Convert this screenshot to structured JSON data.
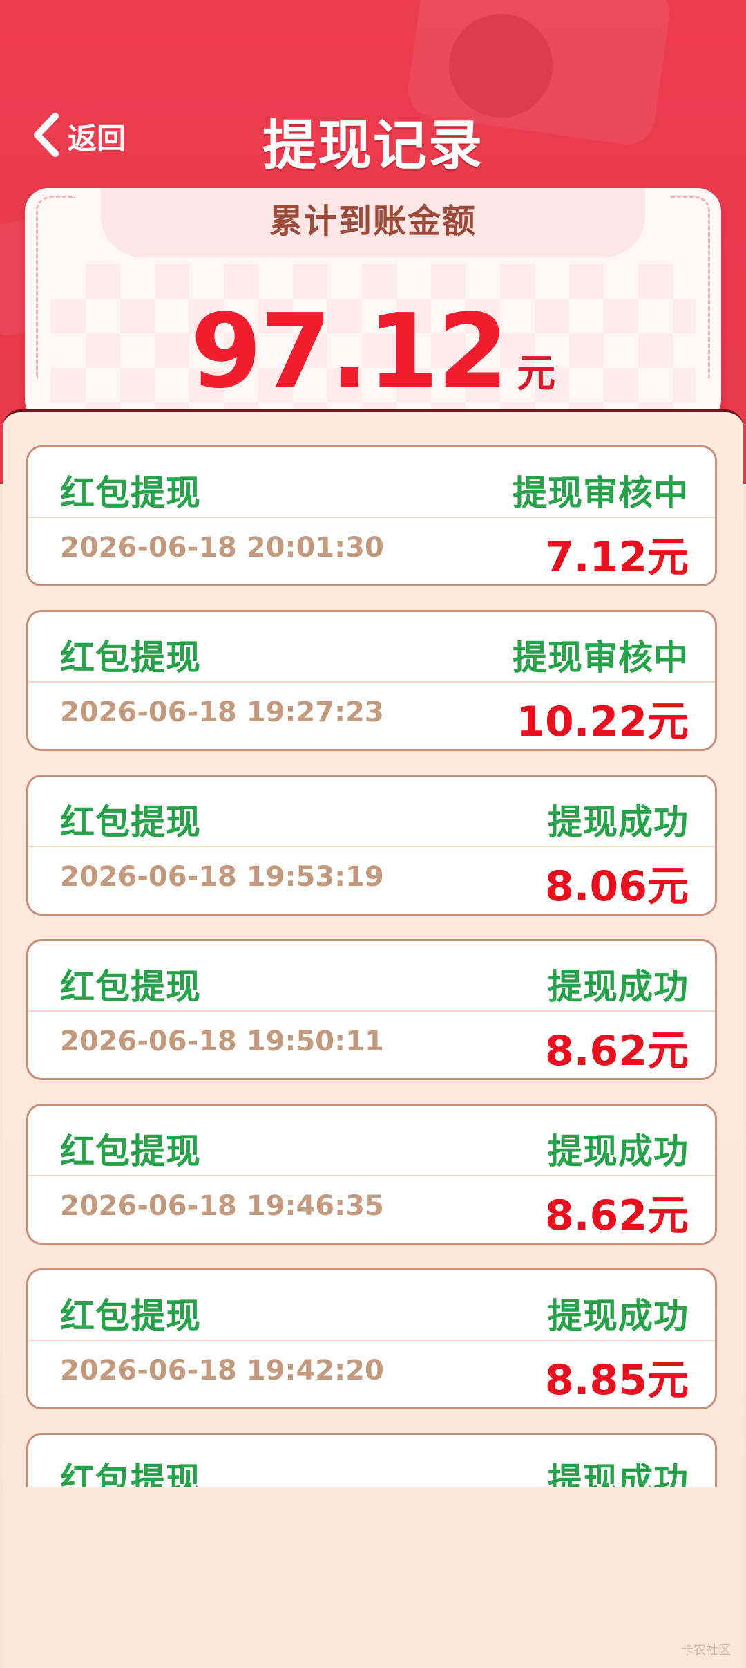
{
  "header": {
    "back_label": "返回",
    "title": "提现记录"
  },
  "summary": {
    "label": "累计到账金额",
    "amount": "97.12",
    "unit": "元"
  },
  "records": [
    {
      "type": "红包提现",
      "status": "提现审核中",
      "time": "2026-06-18 20:01:30",
      "amount": "7.12元"
    },
    {
      "type": "红包提现",
      "status": "提现审核中",
      "time": "2026-06-18 19:27:23",
      "amount": "10.22元"
    },
    {
      "type": "红包提现",
      "status": "提现成功",
      "time": "2026-06-18 19:53:19",
      "amount": "8.06元"
    },
    {
      "type": "红包提现",
      "status": "提现成功",
      "time": "2026-06-18 19:50:11",
      "amount": "8.62元"
    },
    {
      "type": "红包提现",
      "status": "提现成功",
      "time": "2026-06-18 19:46:35",
      "amount": "8.62元"
    },
    {
      "type": "红包提现",
      "status": "提现成功",
      "time": "2026-06-18 19:42:20",
      "amount": "8.85元"
    },
    {
      "type": "红包提现",
      "status": "提现成功",
      "time": "",
      "amount": ""
    }
  ],
  "watermark": "卡农社区",
  "colors": {
    "header_red": "#ec3d4f",
    "status_green": "#27a24a",
    "amount_red": "#e8101f",
    "time_tan": "#c49a7e"
  }
}
